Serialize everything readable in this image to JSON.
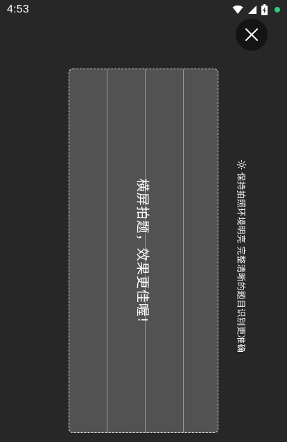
{
  "status_bar": {
    "time": "4:53",
    "icons": [
      "wifi-icon",
      "signal-icon",
      "battery-charging-icon",
      "notification-dot-icon"
    ],
    "dot_color": "#2ecf7a"
  },
  "close_button": {
    "icon": "close-icon"
  },
  "capture_frame": {
    "hint": "横屏拍题，效果更佳喔!"
  },
  "tip": {
    "icon": "sun-icon",
    "text": "保持拍照环境明亮 完整清晰的题目识别更准确"
  },
  "colors": {
    "background": "#272727",
    "frame": "#525252",
    "frame_border": "#e6e6e6",
    "close_bg": "#141414"
  }
}
